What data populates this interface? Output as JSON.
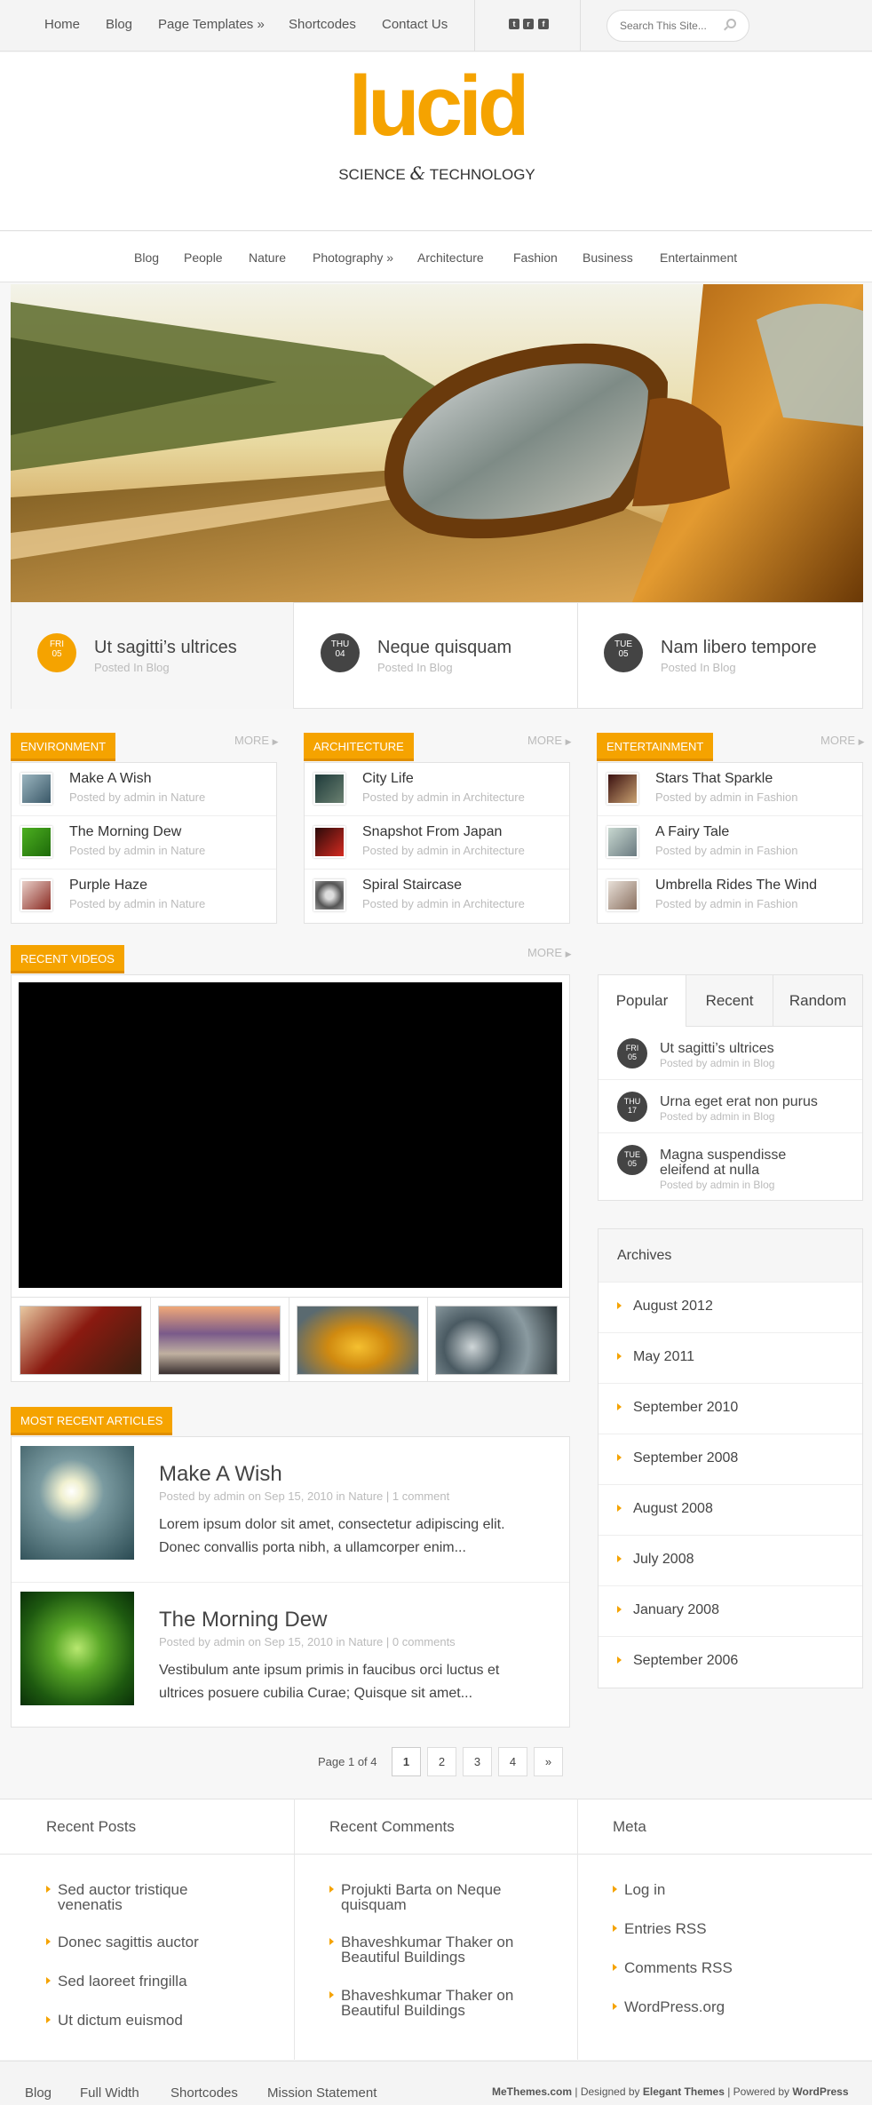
{
  "topnav": {
    "items": [
      "Home",
      "Blog",
      "Page Templates »",
      "Shortcodes",
      "Contact Us"
    ],
    "search_placeholder": "Search This Site..."
  },
  "social": {
    "twitter": "t",
    "rss": "r",
    "facebook": "f"
  },
  "header": {
    "logo": "lucid",
    "tagline_left": "SCIENCE",
    "tagline_amp": "&",
    "tagline_right": "TECHNOLOGY"
  },
  "catnav": {
    "items": [
      "Blog",
      "People",
      "Nature",
      "Photography »",
      "Architecture",
      "Fashion",
      "Business",
      "Entertainment"
    ]
  },
  "featured": [
    {
      "day": "FRI",
      "date": "05",
      "title": "Ut sagitti’s ultrices",
      "sub": "Posted In Blog"
    },
    {
      "day": "THU",
      "date": "04",
      "title": "Neque quisquam",
      "sub": "Posted In Blog"
    },
    {
      "day": "TUE",
      "date": "05",
      "title": "Nam libero tempore",
      "sub": "Posted In Blog"
    }
  ],
  "more_label": "MORE",
  "category_boxes": [
    {
      "title": "ENVIRONMENT",
      "posts": [
        {
          "title": "Make A Wish",
          "meta": "Posted by admin in Nature"
        },
        {
          "title": "The Morning Dew",
          "meta": "Posted by admin in Nature"
        },
        {
          "title": "Purple Haze",
          "meta": "Posted by admin in Nature"
        }
      ]
    },
    {
      "title": "ARCHITECTURE",
      "posts": [
        {
          "title": "City Life",
          "meta": "Posted by admin in Architecture"
        },
        {
          "title": "Snapshot From Japan",
          "meta": "Posted by admin in Architecture"
        },
        {
          "title": "Spiral Staircase",
          "meta": "Posted by admin in Architecture"
        }
      ]
    },
    {
      "title": "ENTERTAINMENT",
      "posts": [
        {
          "title": "Stars That Sparkle",
          "meta": "Posted by admin in Fashion"
        },
        {
          "title": "A Fairy Tale",
          "meta": "Posted by admin in Fashion"
        },
        {
          "title": "Umbrella Rides The Wind",
          "meta": "Posted by admin in Fashion"
        }
      ]
    }
  ],
  "videos": {
    "title": "RECENT VIDEOS"
  },
  "tabs_widget": {
    "tabs": [
      "Popular",
      "Recent",
      "Random"
    ],
    "active": "Popular",
    "posts": [
      {
        "day": "FRI",
        "date": "05",
        "title": "Ut sagitti’s ultrices",
        "meta": "Posted by admin in Blog"
      },
      {
        "day": "THU",
        "date": "17",
        "title": "Urna eget erat non purus",
        "meta": "Posted by admin in Blog"
      },
      {
        "day": "TUE",
        "date": "05",
        "title_line1": "Magna suspendisse",
        "title_line2": "eleifend at nulla",
        "meta": "Posted by admin in Blog"
      }
    ]
  },
  "archives": {
    "title": "Archives",
    "items": [
      "August 2012",
      "May 2011",
      "September 2010",
      "September 2008",
      "August 2008",
      "July 2008",
      "January 2008",
      "September 2006"
    ]
  },
  "articles": {
    "title": "MOST RECENT ARTICLES",
    "items": [
      {
        "title": "Make A Wish",
        "meta_prefix": "Posted by ",
        "author": "admin",
        "meta_on": " on Sep 15, 2010 in ",
        "category": "Nature",
        "meta_sep": " | ",
        "comments": "1 comment",
        "line1": "Lorem ipsum dolor sit amet, consectetur adipiscing elit.",
        "line2": "Donec convallis porta nibh, a ullamcorper enim..."
      },
      {
        "title": "The Morning Dew",
        "meta_prefix": "Posted by ",
        "author": "admin",
        "meta_on": " on Sep 15, 2010 in ",
        "category": "Nature",
        "meta_sep": " | ",
        "comments": "0 comments",
        "line1": "Vestibulum ante ipsum primis in faucibus orci luctus et",
        "line2": "ultrices posuere cubilia Curae; Quisque sit amet..."
      }
    ]
  },
  "pagination": {
    "label": "Page 1 of 4",
    "pages": [
      "1",
      "2",
      "3",
      "4",
      "»"
    ],
    "current": "1"
  },
  "footer": {
    "recent_posts": {
      "title": "Recent Posts",
      "items": [
        [
          "Sed auctor tristique",
          "venenatis"
        ],
        [
          "Donec sagittis auctor"
        ],
        [
          "Sed laoreet fringilla"
        ],
        [
          "Ut dictum euismod"
        ]
      ]
    },
    "recent_comments": {
      "title": "Recent Comments",
      "items": [
        [
          "Projukti Barta on Neque",
          "quisquam"
        ],
        [
          "Bhaveshkumar Thaker on",
          "Beautiful Buildings"
        ],
        [
          "Bhaveshkumar Thaker on",
          "Beautiful Buildings"
        ]
      ]
    },
    "meta": {
      "title": "Meta",
      "items": [
        "Log in",
        "Entries RSS",
        "Comments RSS",
        "WordPress.org"
      ]
    }
  },
  "bottom": {
    "nav": [
      "Blog",
      "Full Width",
      "Shortcodes",
      "Mission Statement"
    ],
    "credits": {
      "site": "MeThemes.com",
      "sep1": " | Designed by ",
      "designer": "Elegant Themes",
      "sep2": " | Powered by ",
      "platform": "WordPress"
    }
  },
  "colors": {
    "accent": "#f5a300",
    "dark_badge": "#444444",
    "text": "#555555",
    "muted": "#bbbbbb"
  }
}
